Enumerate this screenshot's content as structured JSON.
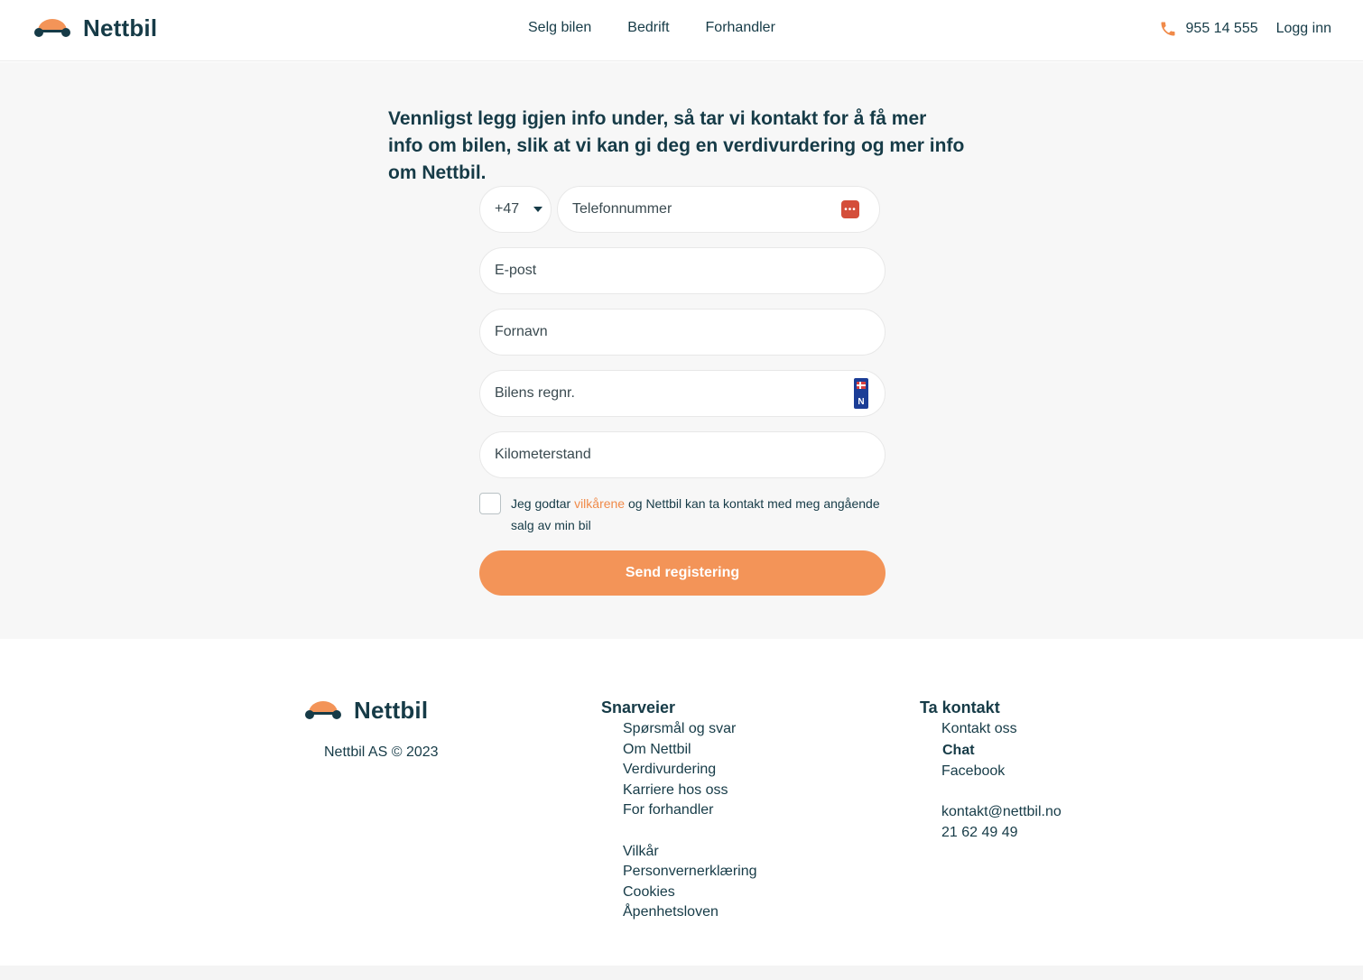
{
  "brand": {
    "name": "Nettbil",
    "accent": "#f39458",
    "dark": "#163b47"
  },
  "header": {
    "nav": [
      "Selg bilen",
      "Bedrift",
      "Forhandler"
    ],
    "phone_icon": "phone-icon",
    "phone": "955 14 555",
    "login": "Logg inn"
  },
  "form": {
    "heading": "Vennligst legg igjen info under, så tar vi kontakt for å få mer info om bilen, slik at vi kan gi deg en verdivurdering og mer info om Nettbil.",
    "country_code": "+47",
    "phone_placeholder": "Telefonnummer",
    "email_placeholder": "E-post",
    "firstname_placeholder": "Fornavn",
    "reg_placeholder": "Bilens regnr.",
    "plate_letter": "N",
    "km_placeholder": "Kilometerstand",
    "consent_prefix": "Jeg godtar ",
    "consent_link": "vilkårene",
    "consent_suffix": " og Nettbil kan ta kontakt med meg angående salg av min bil",
    "submit": "Send registering"
  },
  "footer": {
    "copyright": "Nettbil AS © 2023",
    "shortcuts_title": "Snarveier",
    "shortcuts": [
      "Spørsmål og svar",
      "Om Nettbil",
      "Verdivurdering",
      "Karriere hos oss",
      "For forhandler"
    ],
    "legal": [
      "Vilkår",
      "Personvernerklæring",
      "Cookies",
      "Åpenhetsloven"
    ],
    "contact_title": "Ta kontakt",
    "contact_links": [
      "Kontakt oss",
      "Chat",
      "Facebook"
    ],
    "email": "kontakt@nettbil.no",
    "phone": "21 62 49 49"
  }
}
